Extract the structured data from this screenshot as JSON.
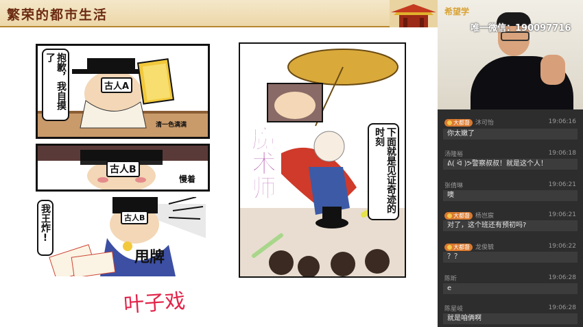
{
  "slide": {
    "title": "繁荣的都市生活",
    "panel1": {
      "bubble": "抱歉，我自摸了",
      "label": "古人A",
      "sfx": "清一色满满"
    },
    "panel2": {
      "label": "古人B",
      "bubble": "慢着"
    },
    "panel3": {
      "bubble": "我王炸!",
      "label": "古人B",
      "sfx": "甩牌"
    },
    "panel4": {
      "bubble": "下面就是见证奇迹的时刻",
      "title": "魔术师"
    },
    "annotation": "叶子戏"
  },
  "video": {
    "brand": "希望学",
    "wechat": "唯一微信：190097716"
  },
  "chat": {
    "messages": [
      {
        "badge": "大都督",
        "user": "沐可怡",
        "time": "19:06:16",
        "text": "你太嫩了"
      },
      {
        "badge": "",
        "user": "汤隆裕",
        "time": "19:06:18",
        "text": "ᕕ( ᐛ )ᕗ警察叔叔！就是这个人！"
      },
      {
        "badge": "",
        "user": "张倩琳",
        "time": "19:06:21",
        "text": "噢"
      },
      {
        "badge": "大都督",
        "user": "杨岂宸",
        "time": "19:06:21",
        "text": "对了，这个班还有预初吗?"
      },
      {
        "badge": "大都督",
        "user": "龙俊毓",
        "time": "19:06:22",
        "text": "？？"
      },
      {
        "badge": "",
        "user": "陈昕",
        "time": "19:06:28",
        "text": "e"
      },
      {
        "badge": "",
        "user": "陈星岐",
        "time": "19:06:28",
        "text": "就是咱俩啊"
      }
    ]
  },
  "colors": {
    "header_bg": "#ecd7a8",
    "title": "#6b2a12",
    "annotation": "#e2244a",
    "badge": "#d9792f",
    "chat_bg": "#2d2d2d"
  }
}
